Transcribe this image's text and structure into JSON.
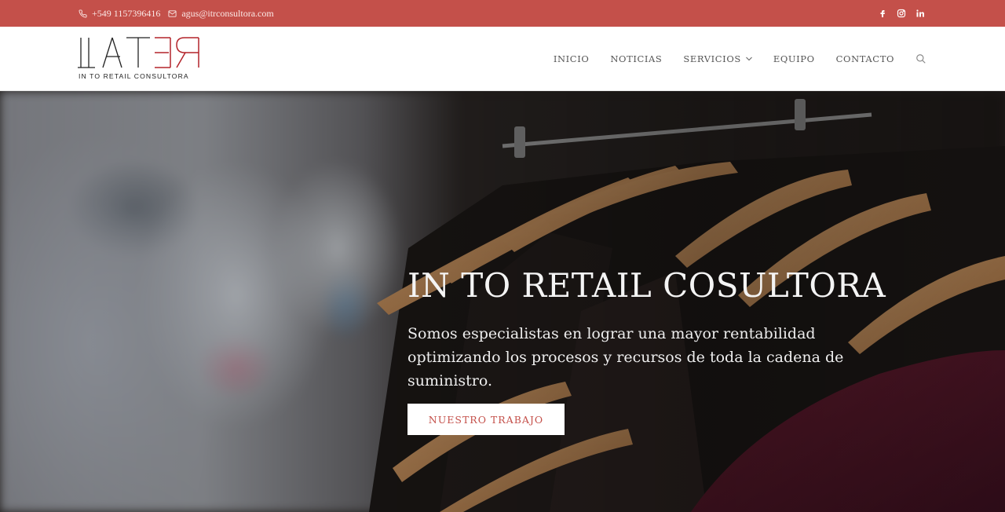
{
  "topbar": {
    "phone": "+549 1157396416",
    "email": "agus@itrconsultora.com",
    "phone_icon": "phone-icon",
    "email_icon": "envelope-icon",
    "social": [
      {
        "name": "facebook-icon",
        "glyph": "f"
      },
      {
        "name": "instagram-icon",
        "glyph": ""
      },
      {
        "name": "linkedin-icon",
        "glyph": "in"
      }
    ],
    "bg_color": "#c4504a"
  },
  "header": {
    "logo_tagline": "IN TO RETAIL CONSULTORA",
    "nav": {
      "inicio": "INICIO",
      "noticias": "NOTICIAS",
      "servicios": "SERVICIOS",
      "equipo": "EQUIPO",
      "contacto": "CONTACTO"
    },
    "search_icon": "search-icon"
  },
  "hero": {
    "title": "IN TO RETAIL COSULTORA",
    "subtitle": "Somos especialistas en lograr una mayor rentabilidad optimizando los procesos y recursos de toda la cadena de suministro.",
    "cta_label": "NUESTRO TRABAJO",
    "accent_color": "#c4504a"
  }
}
